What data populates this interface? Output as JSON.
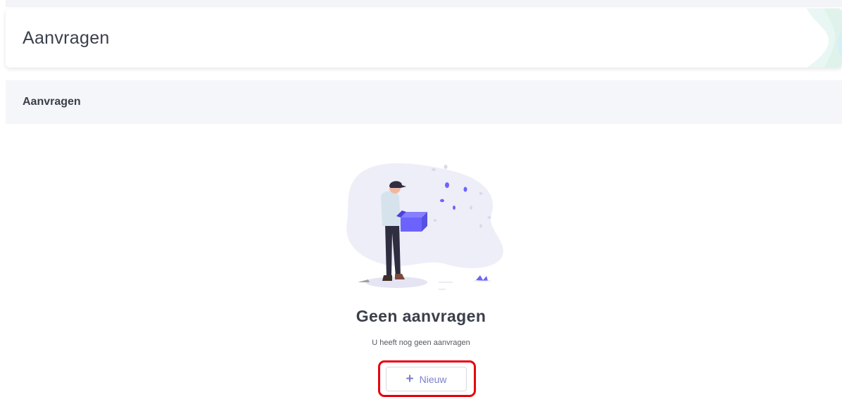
{
  "header": {
    "title": "Aanvragen"
  },
  "section": {
    "title": "Aanvragen"
  },
  "empty_state": {
    "title": "Geen aanvragen",
    "subtitle": "U heeft nog geen aanvragen",
    "new_button_label": "Nieuw",
    "new_button_icon": "plus-icon",
    "illustration": "person-holding-empty-box-illustration"
  },
  "colors": {
    "accent": "#6c63ff",
    "highlight": "#e8000b",
    "button_text": "#7b81c9"
  }
}
